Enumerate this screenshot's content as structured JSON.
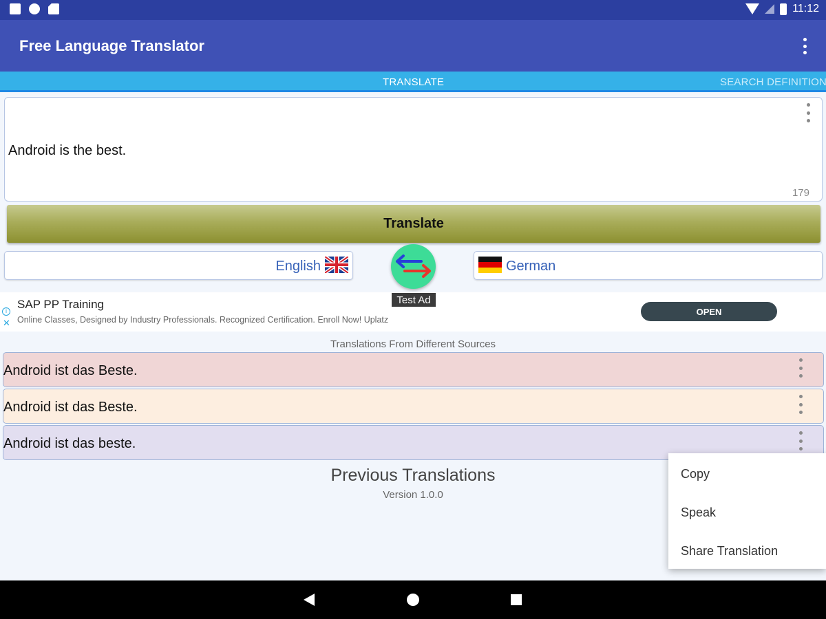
{
  "status_bar": {
    "time": "11:12"
  },
  "toolbar": {
    "title": "Free Language Translator"
  },
  "tabs": [
    {
      "label": "TRANSLATE",
      "active": true
    },
    {
      "label": "SEARCH DEFINITION",
      "active": false
    }
  ],
  "input": {
    "text": "Android is the best.",
    "char_count": "179"
  },
  "translate_button": {
    "label": "Translate"
  },
  "languages": {
    "source": "English",
    "target": "German"
  },
  "ad": {
    "tag": "Test Ad",
    "title": "SAP PP Training",
    "description": "Online Classes, Designed by Industry Professionals. Recognized Certification. Enroll Now! Uplatz",
    "button_label": "OPEN"
  },
  "results": {
    "section_label": "Translations From Different Sources",
    "items": [
      {
        "text": "Android ist das Beste.",
        "color": "#f0d6d6"
      },
      {
        "text": "Android ist das Beste.",
        "color": "#fdeee0"
      },
      {
        "text": "Android ist das beste.",
        "color": "#e2def0"
      }
    ]
  },
  "footer": {
    "previous_title": "Previous Translations",
    "version": "Version 1.0.0"
  },
  "popup_menu": {
    "items": [
      "Copy",
      "Speak",
      "Share Translation"
    ]
  },
  "colors": {
    "toolbar": "#3f51b5",
    "status_bar": "#2c3fa0",
    "tabs": "#35b1e8",
    "swap_button": "#3ddc97"
  }
}
